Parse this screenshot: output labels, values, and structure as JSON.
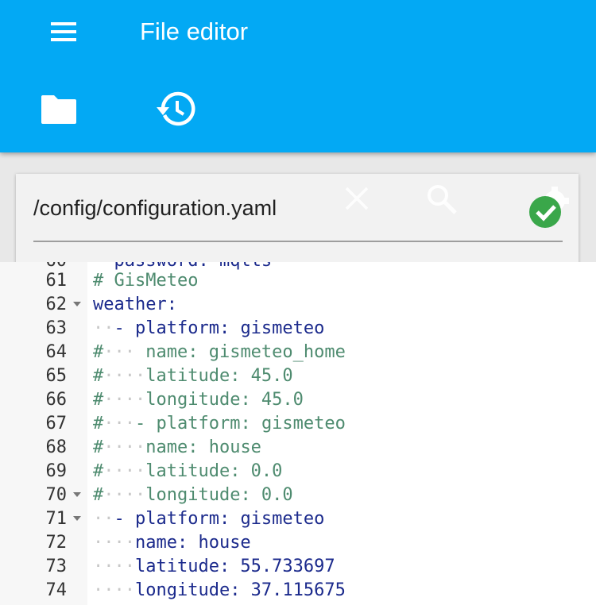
{
  "app": {
    "title": "File editor"
  },
  "file": {
    "path": "/config/configuration.yaml"
  },
  "editor": {
    "partial_line": "password: mqtts",
    "lines": [
      {
        "num": "61",
        "text": "# GisMeteo"
      },
      {
        "num": "62",
        "text": "weather:"
      },
      {
        "num": "63",
        "text": "- platform: gismeteo"
      },
      {
        "num": "64",
        "text": "name: gismeteo_home"
      },
      {
        "num": "65",
        "text": "latitude: 45.0"
      },
      {
        "num": "66",
        "text": "longitude: 45.0"
      },
      {
        "num": "67",
        "text": "- platform: gismeteo"
      },
      {
        "num": "68",
        "text": "name: house"
      },
      {
        "num": "69",
        "text": "latitude: 0.0"
      },
      {
        "num": "70",
        "text": "longitude: 0.0"
      },
      {
        "num": "71",
        "text": "- platform: gismeteo"
      },
      {
        "num": "72",
        "text": "name: house"
      },
      {
        "num": "73",
        "text": "latitude: 55.733697"
      },
      {
        "num": "74",
        "text": "longitude: 37.115675"
      }
    ]
  },
  "icons": {
    "menu": "menu-icon",
    "folder": "folder-icon",
    "history": "history-icon",
    "close": "close-icon",
    "search": "search-icon",
    "save": "save-check-icon"
  },
  "colors": {
    "appbar": "#03a9f4",
    "save_ok": "#3aa74a",
    "comment": "#4e8b6f",
    "key": "#1b2a8c",
    "dash": "#a0198f"
  }
}
